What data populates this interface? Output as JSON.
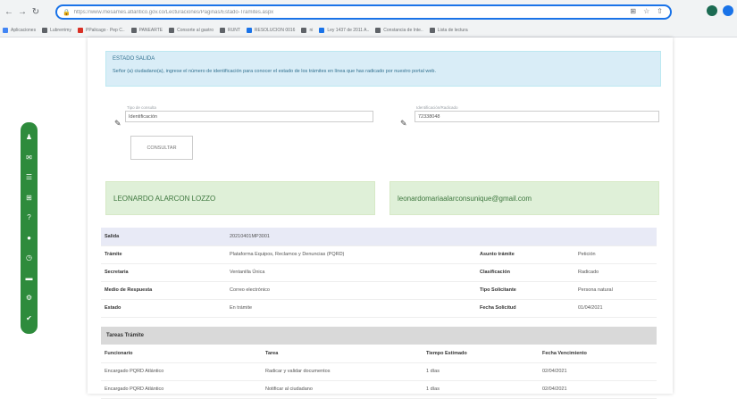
{
  "browser": {
    "url": "https://www.mesames.atlantico.gov.co/Lecturaciones/Paginas/Estado-Tramites.aspx",
    "bookmarks": [
      {
        "label": "Aplicaciones",
        "color": "#4285f4"
      },
      {
        "label": "Lubrerrimy",
        "color": "#5f6368"
      },
      {
        "label": "PPalicago · Pep C..",
        "color": "#d93025"
      },
      {
        "label": "PANEARTE",
        "color": "#5f6368"
      },
      {
        "label": "Consorte al gastro",
        "color": "#5f6368"
      },
      {
        "label": "RUNT",
        "color": "#5f6368"
      },
      {
        "label": "RESOLUCION 0016",
        "color": "#1a73e8"
      },
      {
        "label": "ni",
        "color": "#5f6368"
      },
      {
        "label": "Ley 1437 de 2011 A..",
        "color": "#1a73e8"
      },
      {
        "label": "Constancia de Inte..",
        "color": "#5f6368"
      },
      {
        "label": "Lista de lectura",
        "color": "#5f6368"
      }
    ]
  },
  "info": {
    "title": "ESTADO SALIDA",
    "text": "Señor (a) ciudadano(a), ingrese el número de identificación para conocer el estado de los trámites en línea que has radicado por nuestro portal web."
  },
  "form": {
    "type_label": "Tipo de consulta",
    "type_value": "Identificación",
    "id_label": "Identificación/Radicado",
    "id_value": "72338048",
    "consult_button": "CONSULTAR"
  },
  "result": {
    "name": "LEONARDO ALARCON LOZZO",
    "email": "leonardomariaalarconsunique@gmail.com"
  },
  "details": {
    "radicado_label": "Salida",
    "radicado_value": "20210401MP3001",
    "rows": [
      {
        "k1": "Trámite",
        "v1": "Plataforma Equipos, Reclamos y Denuncias (PQRD)",
        "k2": "Asunto trámite",
        "v2": "Petición"
      },
      {
        "k1": "Secretaria",
        "v1": "Ventanilla Única",
        "k2": "Clasificación",
        "v2": "Radicado"
      },
      {
        "k1": "Medio de Respuesta",
        "v1": "Correo electrónico",
        "k2": "Tipo Solicitante",
        "v2": "Persona natural"
      },
      {
        "k1": "Estado",
        "v1": "En trámite",
        "k2": "Fecha Solicitud",
        "v2": "01/04/2021"
      }
    ]
  },
  "tasks": {
    "title": "Tareas Trámite",
    "headers": [
      "Funcionario",
      "Tarea",
      "Tiempo Estimado",
      "Fecha Vencimiento"
    ],
    "rows": [
      [
        "Encargado PQRD Atlántico",
        "Radicar y validar documentos",
        "1 días",
        "02/04/2021"
      ],
      [
        "Encargado PQRD Atlántico",
        "Notificar al ciudadano",
        "1 días",
        "02/04/2021"
      ]
    ]
  },
  "side_icons": [
    "user-icon",
    "mail-icon",
    "list-icon",
    "grid-icon",
    "help-icon",
    "location-icon",
    "clock-icon",
    "chat-icon",
    "settings-icon",
    "check-icon"
  ],
  "colors": {
    "accent_green": "#2e8b3c",
    "info_bg": "#d9edf7",
    "success_bg": "#dff0d8",
    "omnibox_focus": "#1a73e8"
  }
}
